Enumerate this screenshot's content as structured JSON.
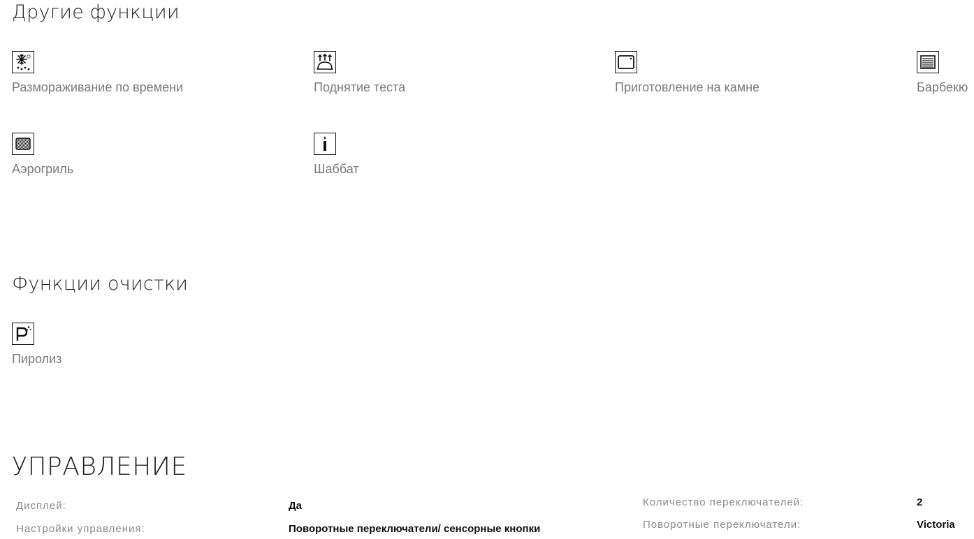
{
  "other_functions": {
    "title": "Другие функции",
    "items": [
      {
        "label": "Размораживание по времени",
        "icon": "defrost-snowflake-icon"
      },
      {
        "label": "Поднятие теста",
        "icon": "dough-proving-icon"
      },
      {
        "label": "Приготовление на камне",
        "icon": "pizza-stone-icon"
      },
      {
        "label": "Барбекю",
        "icon": "barbecue-grill-icon"
      },
      {
        "label": "Аэрогриль",
        "icon": "air-fry-icon"
      },
      {
        "label": "Шаббат",
        "icon": "sabbath-candle-icon"
      }
    ]
  },
  "cleaning_functions": {
    "title": "Функции очистки",
    "items": [
      {
        "label": "Пиролиз",
        "icon": "pyrolysis-icon"
      }
    ]
  },
  "management": {
    "title": "УПРАВЛЕНИЕ",
    "left": [
      {
        "label": "Дисплей:",
        "value": "Да"
      },
      {
        "label": "Настройки управления:",
        "value": "Поворотные переключатели/ сенсорные кнопки"
      }
    ],
    "right": [
      {
        "label": "Количество переключателей:",
        "value": "2"
      },
      {
        "label": "Поворотные переключатели:",
        "value": "Victoria"
      }
    ]
  }
}
